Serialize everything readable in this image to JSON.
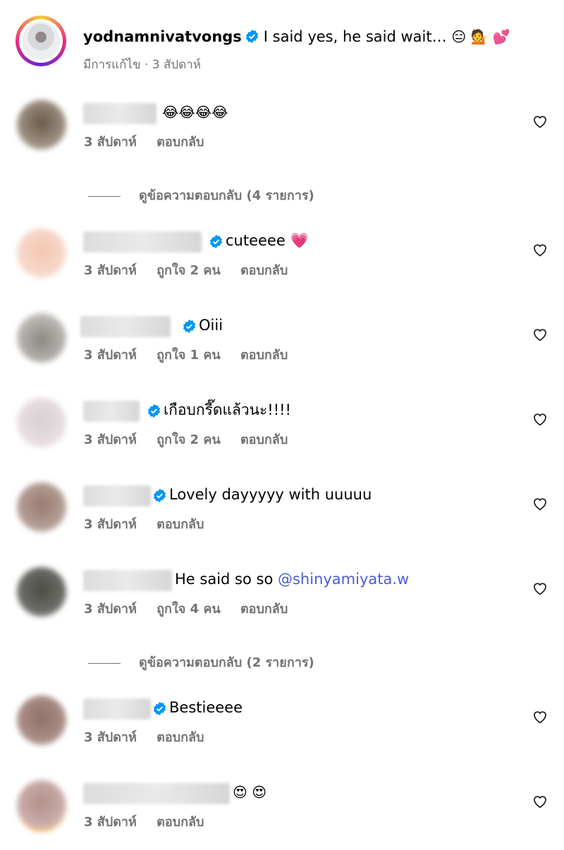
{
  "post": {
    "username": "yodnamnivatvongs",
    "caption_text": "I said yes, he said wait…",
    "caption_emojis": "😑 💁 💕",
    "meta": "มีการแก้ไข · 3 สัปดาห์"
  },
  "labels": {
    "reply": "ตอบกลับ"
  },
  "comments": [
    {
      "text": "😂😂😂😂",
      "time": "3 สัปดาห์",
      "likes": "",
      "verified": false
    },
    {
      "text": "cuteeee 💗",
      "time": "3 สัปดาห์",
      "likes": "ถูกใจ 2 คน",
      "verified": true
    },
    {
      "text": "Oiii",
      "time": "3 สัปดาห์",
      "likes": "ถูกใจ 1 คน",
      "verified": true
    },
    {
      "text": "เกือบกรี๊ดแล้วนะ!!!!",
      "time": "3 สัปดาห์",
      "likes": "ถูกใจ 2 คน",
      "verified": true
    },
    {
      "text": "Lovely dayyyyy with uuuuu",
      "time": "3 สัปดาห์",
      "likes": "",
      "verified": true
    },
    {
      "text": "He said so so",
      "mention": "@shinyamiyata.w",
      "time": "3 สัปดาห์",
      "likes": "ถูกใจ 4 คน",
      "verified": false
    },
    {
      "text": "Bestieeee",
      "time": "3 สัปดาห์",
      "likes": "",
      "verified": true
    },
    {
      "text": "😍 😍",
      "time": "3 สัปดาห์",
      "likes": "",
      "verified": false
    }
  ],
  "view_replies": [
    {
      "label": "ดูข้อความตอบกลับ (4 รายการ)"
    },
    {
      "label": "ดูข้อความตอบกลับ (2 รายการ)"
    }
  ],
  "icons": {
    "verified": "verified-badge-icon",
    "like": "heart-outline-icon"
  },
  "colors": {
    "verified": "#0095f6",
    "mention": "#4a5dd6",
    "meta": "#737373"
  }
}
